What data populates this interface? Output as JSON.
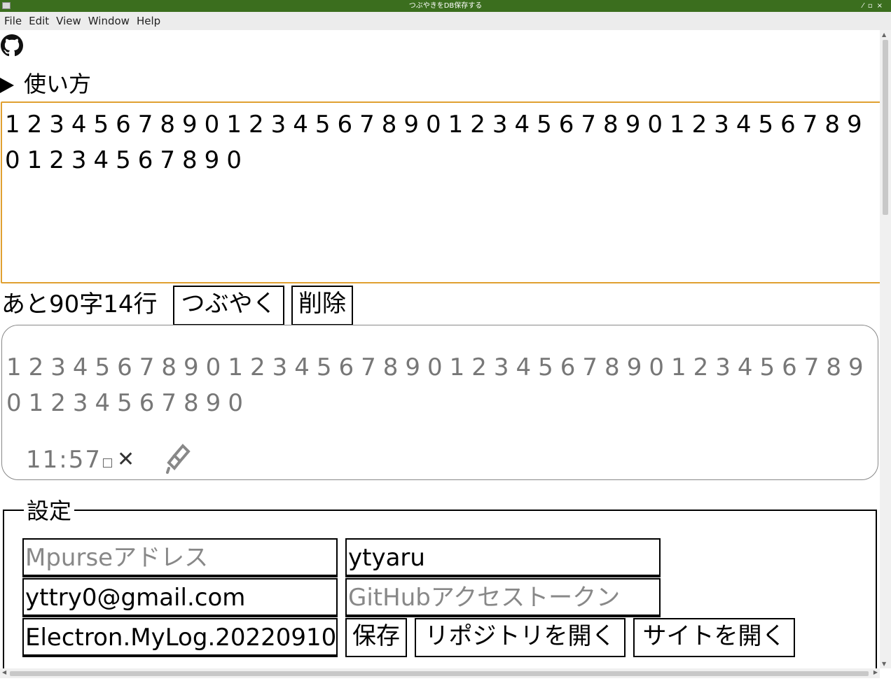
{
  "window": {
    "title": "つぶやきをDB保存する"
  },
  "menu": [
    "File",
    "Edit",
    "View",
    "Window",
    "Help"
  ],
  "usage": {
    "label": "使い方"
  },
  "tweet_input": {
    "value": "12345678901234567890123456789012345678901234567890"
  },
  "counter": {
    "text": "あと90字14行"
  },
  "buttons": {
    "tweet": "つぶやく",
    "delete": "削除"
  },
  "post": {
    "text": "12345678901234567890123456789012345678901234567890",
    "time": "11:57"
  },
  "settings": {
    "legend": "設定",
    "mpurse_placeholder": "Mpurseアドレス",
    "username": "ytyaru",
    "email": "yttry0@gmail.com",
    "token_placeholder": "GitHubアクセストークン",
    "repo": "Electron.MyLog.20220910",
    "save": "保存",
    "open_repo": "リポジトリを開く",
    "open_site": "サイトを開く"
  }
}
